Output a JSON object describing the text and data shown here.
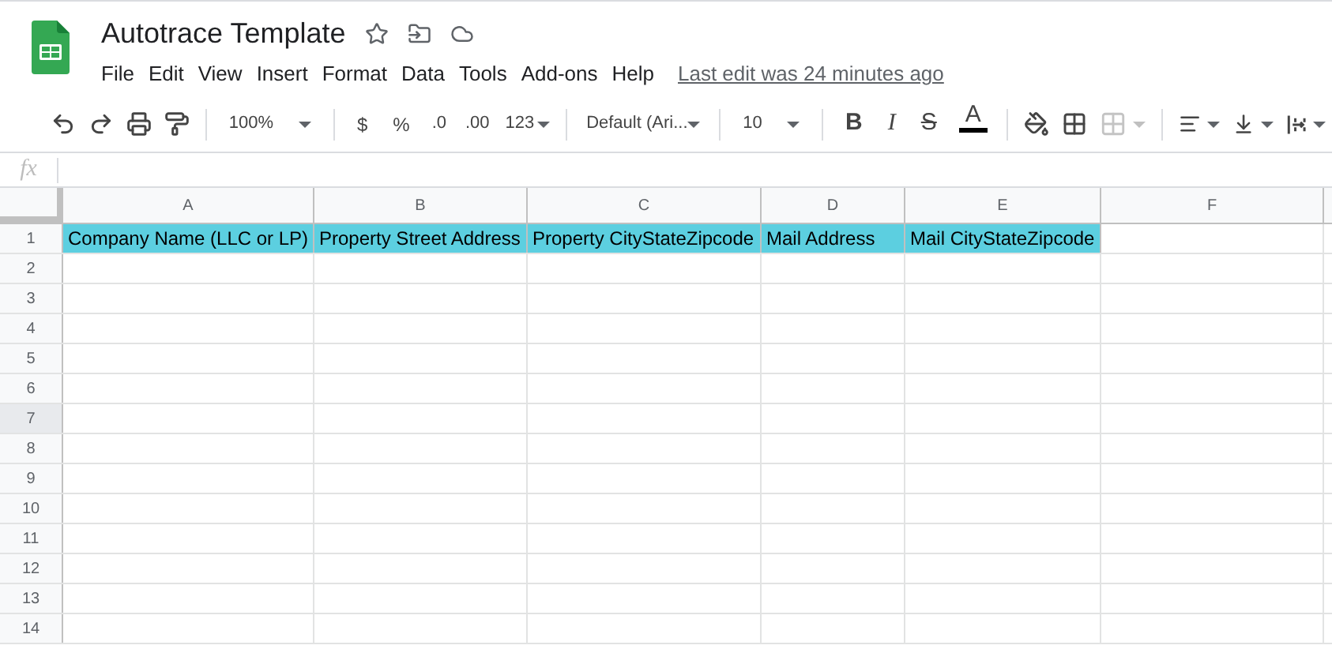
{
  "document": {
    "title": "Autotrace Template",
    "last_edit": "Last edit was 24 minutes ago"
  },
  "menu": [
    "File",
    "Edit",
    "View",
    "Insert",
    "Format",
    "Data",
    "Tools",
    "Add-ons",
    "Help"
  ],
  "toolbar": {
    "zoom": "100%",
    "currency": "$",
    "percent": "%",
    "decrease_decimals": ".0",
    "increase_decimals": ".00",
    "number_format": "123",
    "font": "Default (Ari...",
    "font_size": "10",
    "bold": "B",
    "italic": "I",
    "strikethrough": "S",
    "text_color": "A",
    "merge_disabled": true
  },
  "formula_bar": {
    "label": "fx"
  },
  "columns": [
    "A",
    "B",
    "C",
    "D",
    "E",
    "F"
  ],
  "rows": [
    {
      "label": "1",
      "selected": false,
      "cells": [
        "Company Name (LLC or LP)",
        "Property Street Address",
        "Property CityStateZipcode",
        "Mail Address",
        "Mail CityStateZipcode"
      ]
    },
    {
      "label": "2",
      "selected": false,
      "cells": []
    },
    {
      "label": "3",
      "selected": false,
      "cells": []
    },
    {
      "label": "4",
      "selected": false,
      "cells": []
    },
    {
      "label": "5",
      "selected": false,
      "cells": []
    },
    {
      "label": "6",
      "selected": false,
      "cells": []
    },
    {
      "label": "7",
      "selected": true,
      "cells": []
    },
    {
      "label": "8",
      "selected": false,
      "cells": []
    },
    {
      "label": "9",
      "selected": false,
      "cells": []
    },
    {
      "label": "10",
      "selected": false,
      "cells": []
    },
    {
      "label": "11",
      "selected": false,
      "cells": []
    },
    {
      "label": "12",
      "selected": false,
      "cells": []
    },
    {
      "label": "13",
      "selected": false,
      "cells": []
    },
    {
      "label": "14",
      "selected": false,
      "cells": []
    }
  ]
}
